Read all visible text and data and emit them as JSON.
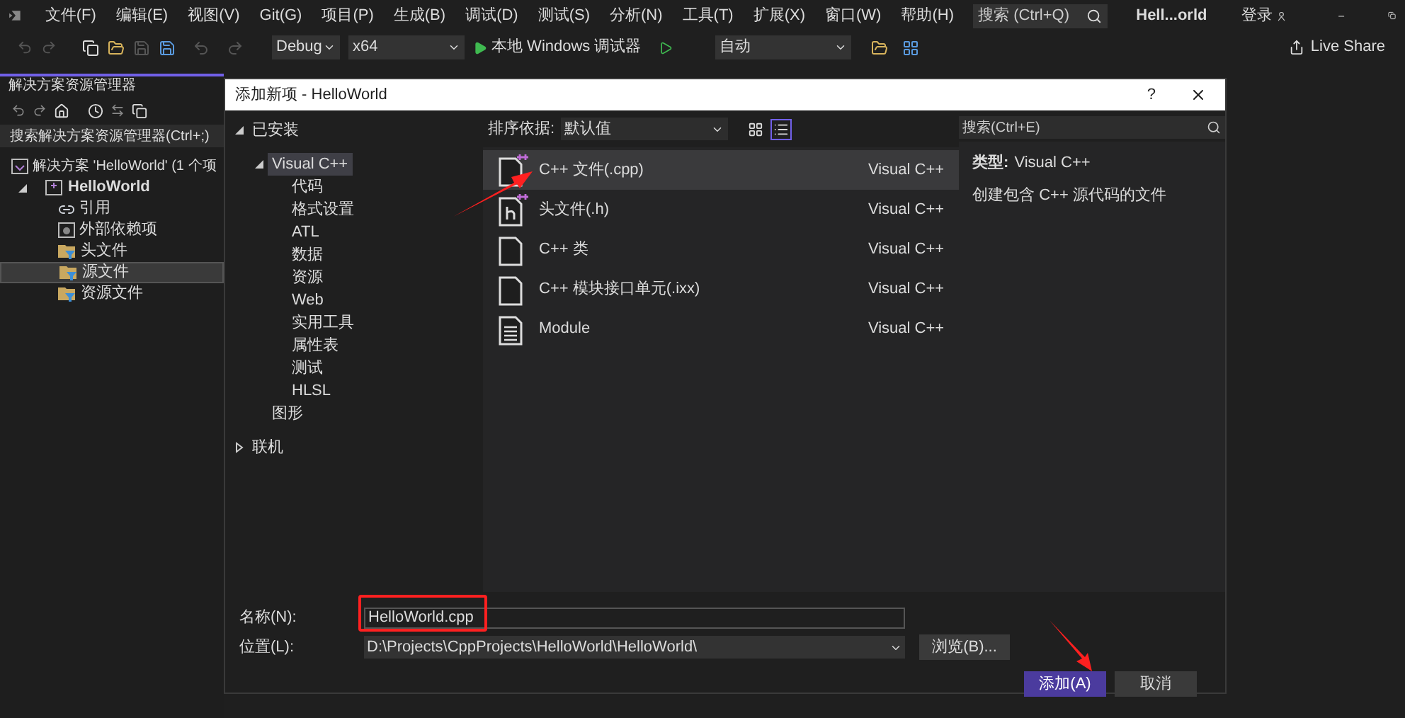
{
  "menu": [
    "文件(F)",
    "编辑(E)",
    "视图(V)",
    "Git(G)",
    "项目(P)",
    "生成(B)",
    "调试(D)",
    "测试(S)",
    "分析(N)",
    "工具(T)",
    "扩展(X)",
    "窗口(W)",
    "帮助(H)"
  ],
  "search": {
    "placeholder": "搜索 (Ctrl+Q)"
  },
  "window_title": "Hell...orld",
  "login": "登录",
  "toolbar": {
    "configuration": "Debug",
    "platform": "x64",
    "run": "本地 Windows 调试器",
    "mode": "自动",
    "live_share": "Live Share"
  },
  "solution_explorer": {
    "title": "解决方案资源管理器",
    "search_placeholder": "搜索解决方案资源管理器(Ctrl+;)",
    "solution": "解决方案 'HelloWorld' (1 个项",
    "project": {
      "label": "HelloWorld",
      "expanded": true,
      "children": [
        {
          "label": "引用",
          "kind": "reference",
          "selected": false
        },
        {
          "label": "外部依赖项",
          "kind": "dependency",
          "selected": false
        },
        {
          "label": "头文件",
          "kind": "filter",
          "selected": false
        },
        {
          "label": "源文件",
          "kind": "filter",
          "selected": true
        },
        {
          "label": "资源文件",
          "kind": "filter",
          "selected": false
        }
      ]
    }
  },
  "dialog": {
    "title": "添加新项 - HelloWorld",
    "help": "?",
    "tree": [
      {
        "label": "已安装",
        "expanded": true,
        "selected": false,
        "children": [
          {
            "label": "Visual C++",
            "expanded": true,
            "selected": true,
            "children": [
              {
                "label": "代码",
                "selected": false
              },
              {
                "label": "格式设置",
                "selected": false
              },
              {
                "label": "ATL",
                "selected": false
              },
              {
                "label": "数据",
                "selected": false
              },
              {
                "label": "资源",
                "selected": false
              },
              {
                "label": "Web",
                "selected": false
              },
              {
                "label": "实用工具",
                "selected": false
              },
              {
                "label": "属性表",
                "selected": false
              },
              {
                "label": "测试",
                "selected": false
              },
              {
                "label": "HLSL",
                "selected": false
              }
            ]
          },
          {
            "label": "图形",
            "selected": false
          }
        ]
      },
      {
        "label": "联机",
        "expanded": false,
        "selected": false
      }
    ],
    "sort_label": "排序依据:",
    "sort_value": "默认值",
    "view_modes": [
      {
        "kind": "grid",
        "selected": false
      },
      {
        "kind": "list",
        "selected": true
      }
    ],
    "templates": [
      {
        "name": "C++ 文件(.cpp)",
        "type": "Visual C++",
        "kind": "cpp",
        "selected": true
      },
      {
        "name": "头文件(.h)",
        "type": "Visual C++",
        "kind": "header",
        "selected": false
      },
      {
        "name": "C++ 类",
        "type": "Visual C++",
        "kind": "blank",
        "selected": false
      },
      {
        "name": "C++ 模块接口单元(.ixx)",
        "type": "Visual C++",
        "kind": "blank",
        "selected": false
      },
      {
        "name": "Module",
        "type": "Visual C++",
        "kind": "module",
        "selected": false
      }
    ],
    "search_placeholder": "搜索(Ctrl+E)",
    "details": {
      "type_label": "类型:",
      "type_value": "Visual C++",
      "description": "创建包含 C++ 源代码的文件"
    },
    "name_label": "名称(N):",
    "name_value": "HelloWorld.cpp",
    "location_label": "位置(L):",
    "location_value": "D:\\Projects\\CppProjects\\HelloWorld\\HelloWorld\\",
    "browse_button": "浏览(B)...",
    "add_button": "添加(A)",
    "cancel_button": "取消"
  }
}
